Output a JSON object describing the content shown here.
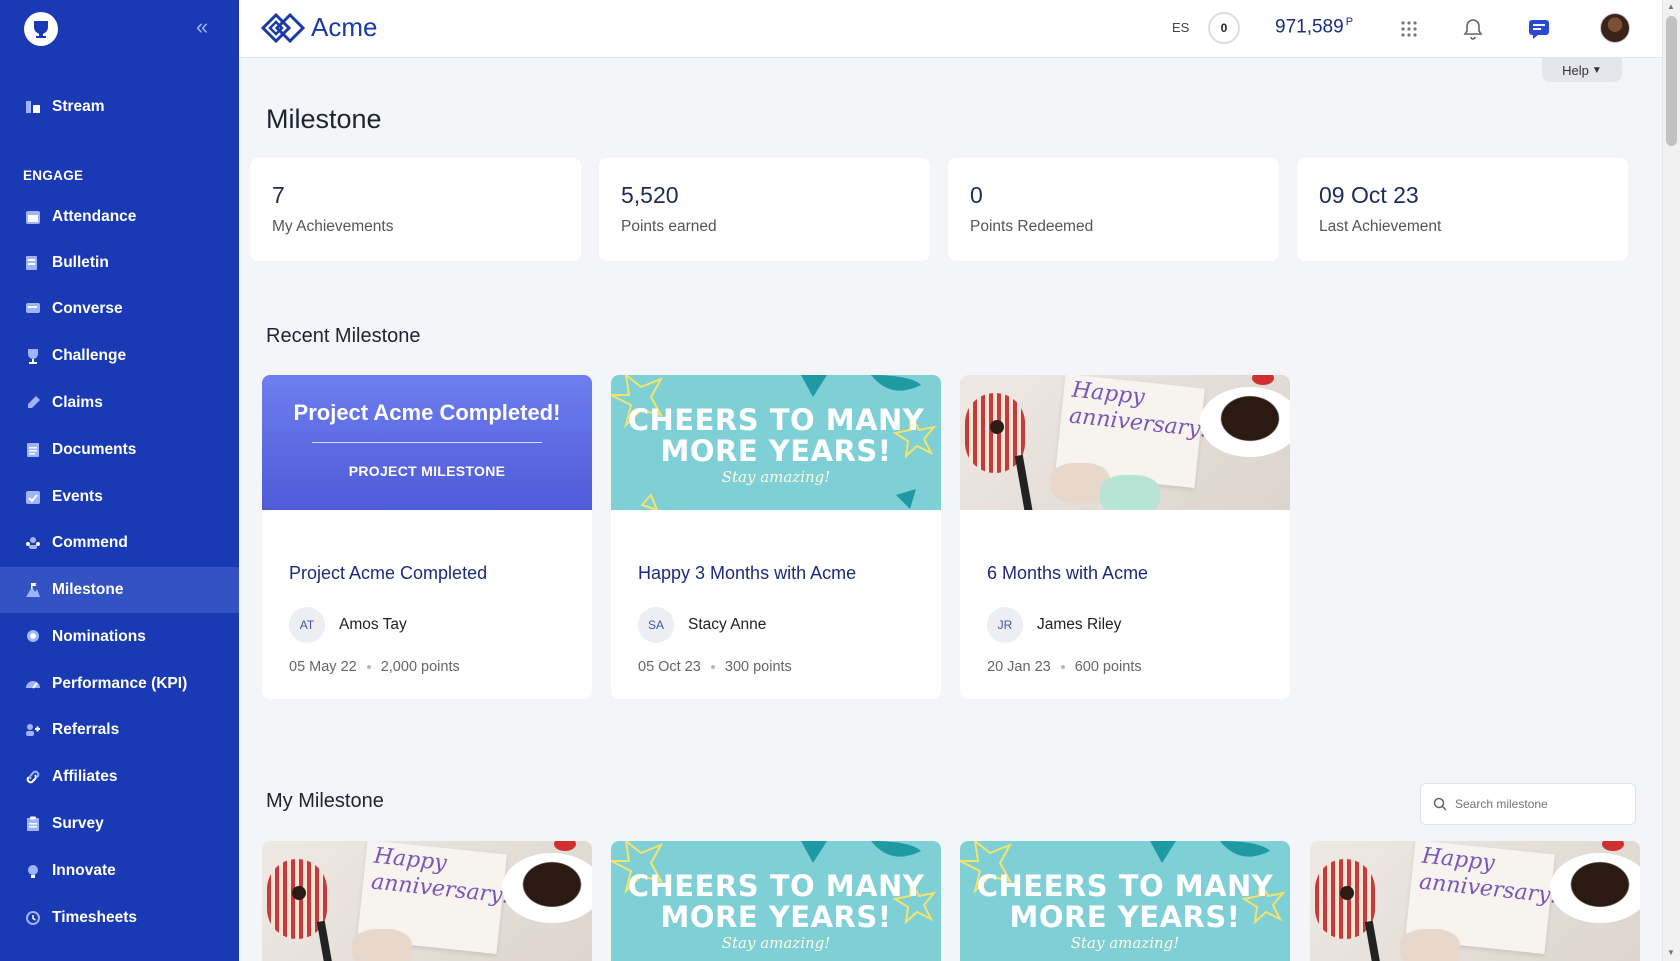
{
  "app": {
    "brand": "Acme"
  },
  "sidebar": {
    "section_label": "ENGAGE",
    "items": [
      {
        "label": "Stream",
        "icon": "stream-icon"
      },
      {
        "label": "Attendance",
        "icon": "calendar-icon"
      },
      {
        "label": "Bulletin",
        "icon": "bulletin-icon"
      },
      {
        "label": "Converse",
        "icon": "chat-icon"
      },
      {
        "label": "Challenge",
        "icon": "trophy-icon"
      },
      {
        "label": "Claims",
        "icon": "claims-icon"
      },
      {
        "label": "Documents",
        "icon": "document-icon"
      },
      {
        "label": "Events",
        "icon": "event-icon"
      },
      {
        "label": "Commend",
        "icon": "commend-icon"
      },
      {
        "label": "Milestone",
        "icon": "milestone-icon",
        "active": true
      },
      {
        "label": "Nominations",
        "icon": "nomination-icon"
      },
      {
        "label": "Performance (KPI)",
        "icon": "performance-icon"
      },
      {
        "label": "Referrals",
        "icon": "referral-icon"
      },
      {
        "label": "Affiliates",
        "icon": "affiliate-icon"
      },
      {
        "label": "Survey",
        "icon": "survey-icon"
      },
      {
        "label": "Innovate",
        "icon": "innovate-icon"
      },
      {
        "label": "Timesheets",
        "icon": "timesheet-icon"
      }
    ]
  },
  "topbar": {
    "language": "ES",
    "coin_count": "0",
    "points": "971,589",
    "points_unit": "P",
    "help_label": "Help"
  },
  "page": {
    "title": "Milestone",
    "stats": [
      {
        "value": "7",
        "label": "My Achievements"
      },
      {
        "value": "5,520",
        "label": "Points earned"
      },
      {
        "value": "0",
        "label": "Points Redeemed"
      },
      {
        "value": "09 Oct 23",
        "label": "Last Achievement"
      }
    ],
    "recent_title": "Recent Milestone",
    "recent_cards": [
      {
        "name": "Project Acme Completed",
        "initials": "AT",
        "person": "Amos Tay",
        "date": "05 May 22",
        "points": "2,000 points",
        "image": {
          "kind": "project",
          "line1": "Project Acme Completed!",
          "line2": "PROJECT MILESTONE"
        }
      },
      {
        "name": "Happy 3 Months with Acme",
        "initials": "SA",
        "person": "Stacy Anne",
        "date": "05 Oct 23",
        "points": "300 points",
        "image": {
          "kind": "cheers",
          "line1": "CHEERS TO MANY MORE YEARS!",
          "line2": "Stay amazing!"
        }
      },
      {
        "name": "6 Months with Acme",
        "initials": "JR",
        "person": "James Riley",
        "date": "20 Jan 23",
        "points": "600 points",
        "image": {
          "kind": "anniversary",
          "line1": "Happy anniversary!"
        }
      }
    ],
    "my_title": "My Milestone",
    "search_placeholder": "Search milestone",
    "my_cards": [
      {
        "image": {
          "kind": "anniversary",
          "line1": "Happy anniversary!"
        }
      },
      {
        "image": {
          "kind": "cheers",
          "line1": "CHEERS TO MANY MORE YEARS!",
          "line2": "Stay amazing!"
        }
      },
      {
        "image": {
          "kind": "cheers",
          "line1": "CHEERS TO MANY MORE YEARS!",
          "line2": "Stay amazing!"
        }
      },
      {
        "image": {
          "kind": "anniversary",
          "line1": "Happy anniversary!"
        }
      }
    ]
  },
  "colors": {
    "sidebar": "#1939b5",
    "sidebar_active": "#3352c3",
    "accent": "#1a3aa8",
    "background": "#f4f5f9"
  }
}
